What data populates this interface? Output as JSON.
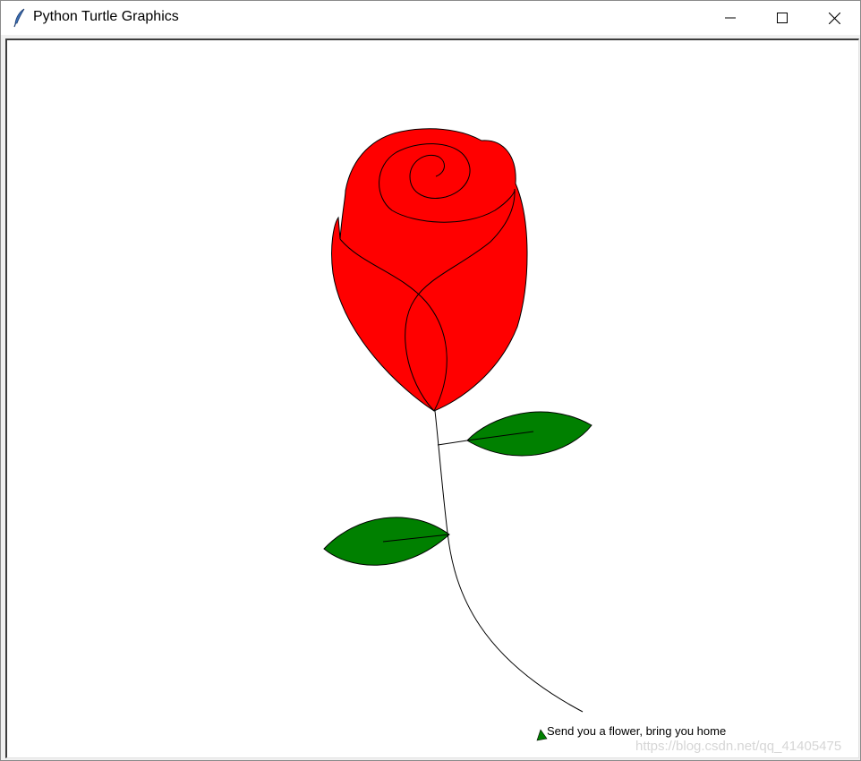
{
  "window": {
    "title": "Python Turtle Graphics",
    "icon": "feather-icon",
    "controls": [
      "minimize-icon",
      "maximize-icon",
      "close-icon"
    ]
  },
  "canvas": {
    "background": "#ffffff",
    "message": "Send you a flower, bring you home",
    "watermark": "https://blog.csdn.net/qq_41405475",
    "colors": {
      "petal": "#ff0000",
      "leaf": "#008000",
      "outline": "#000000",
      "cursor": "#008000"
    },
    "drawing": [
      "rose-head",
      "stem",
      "upper-leaf",
      "lower-leaf",
      "turtle-cursor"
    ]
  }
}
